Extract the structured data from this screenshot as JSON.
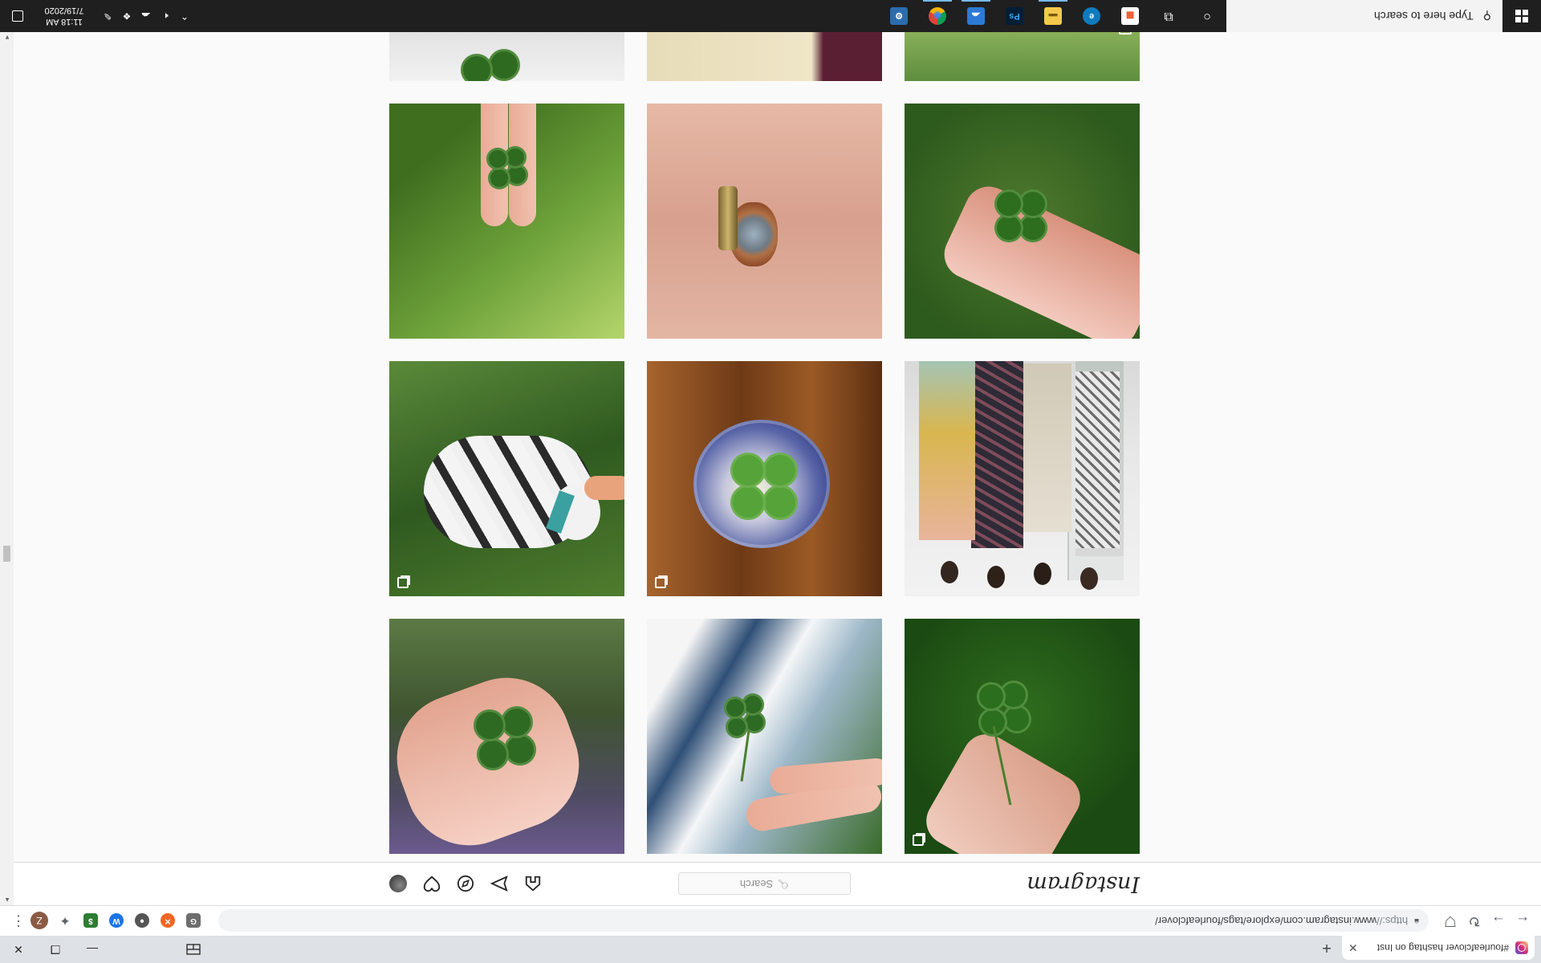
{
  "browser": {
    "tab_title": "#fourleafclover hashtag on Inst",
    "tab_close": "✕",
    "new_tab": "+",
    "url_scheme": "https://",
    "url_rest": "www.instagram.com/explore/tags/fourleafclover/",
    "profile_initial": "Z",
    "window_close": "✕",
    "window_restore": "❐",
    "window_minimize": "—",
    "extensions": [
      {
        "label": "G",
        "color": "#6d6d6d"
      },
      {
        "label": "✕",
        "color": "#f26522"
      },
      {
        "label": "●",
        "color": "#555555"
      },
      {
        "label": "W",
        "color": "#1a73e8"
      },
      {
        "label": "$",
        "color": "#2e7d32"
      }
    ]
  },
  "instagram": {
    "logo": "Instagram",
    "search_placeholder": "Search",
    "nav_icons": [
      "home-icon",
      "messenger-icon",
      "explore-icon",
      "activity-icon",
      "profile-avatar"
    ]
  },
  "taskbar": {
    "search_placeholder": "Type here to search",
    "time": "11:18 AM",
    "date": "7/19/2020",
    "apps": [
      {
        "name": "cortana",
        "glyph": "○"
      },
      {
        "name": "task-view",
        "glyph": "⧉"
      },
      {
        "name": "store",
        "glyph": "▦"
      },
      {
        "name": "edge",
        "glyph": "e"
      },
      {
        "name": "file-explorer",
        "glyph": "▬"
      },
      {
        "name": "photoshop",
        "glyph": "Ps"
      },
      {
        "name": "onedrive-photos",
        "glyph": "☁"
      },
      {
        "name": "chrome",
        "glyph": "◉"
      },
      {
        "name": "settings",
        "glyph": "⚙"
      }
    ]
  },
  "grid_posts": [
    {
      "desc": "hand holding clover on grass",
      "multi": true
    },
    {
      "desc": "hand with clover, blue stripes",
      "multi": false
    },
    {
      "desc": "fingers with clover, purple flowers",
      "multi": false
    },
    {
      "desc": "group of women in dresses",
      "multi": false
    },
    {
      "desc": "clover in glass paperweight",
      "multi": true
    },
    {
      "desc": "puppy on grass",
      "multi": true
    },
    {
      "desc": "clover held over grass",
      "multi": false
    },
    {
      "desc": "bullet casing and ring in palm",
      "multi": false
    },
    {
      "desc": "clover between fingers over basil",
      "multi": false
    },
    {
      "desc": "clover among leaves",
      "multi": false,
      "camera": true
    },
    {
      "desc": "embroidered fabric",
      "multi": false
    },
    {
      "desc": "clover on white",
      "multi": false
    }
  ]
}
